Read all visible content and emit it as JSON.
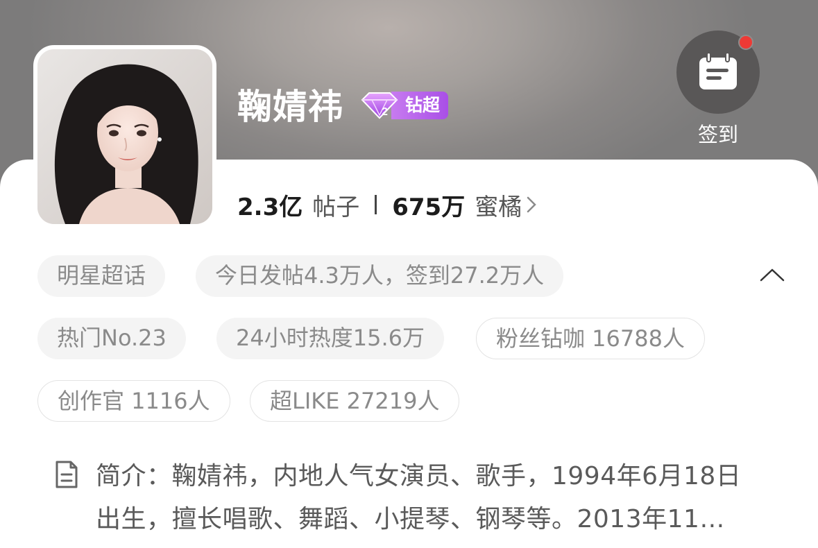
{
  "profile": {
    "name": "鞠婧祎",
    "badge_level": "2",
    "badge_label": "钻超",
    "avatar_alt": "avatar"
  },
  "checkin": {
    "icon": "calendar-icon",
    "label": "签到",
    "has_notification": true
  },
  "stats": {
    "posts_value": "2.3亿",
    "posts_label": "帖子",
    "fans_value": "675万",
    "fans_label": "蜜橘"
  },
  "tags": {
    "row1": [
      "明星超话",
      "今日发帖4.3万人，签到27.2万人"
    ],
    "row2": [
      "热门No.23",
      "24小时热度15.6万",
      "粉丝钻咖 16788人"
    ],
    "row3": [
      "创作官 1116人",
      "超LIKE 27219人"
    ]
  },
  "intro": {
    "line1": "简介：鞠婧祎，内地人气女演员、歌手，1994年6月18日",
    "line2": "出生，擅长唱歌、舞蹈、小提琴、钢琴等。2013年11…"
  },
  "colors": {
    "badge_purple": "#b05ae8",
    "notification_red": "#ee3a35",
    "checkin_bg": "#595757"
  }
}
